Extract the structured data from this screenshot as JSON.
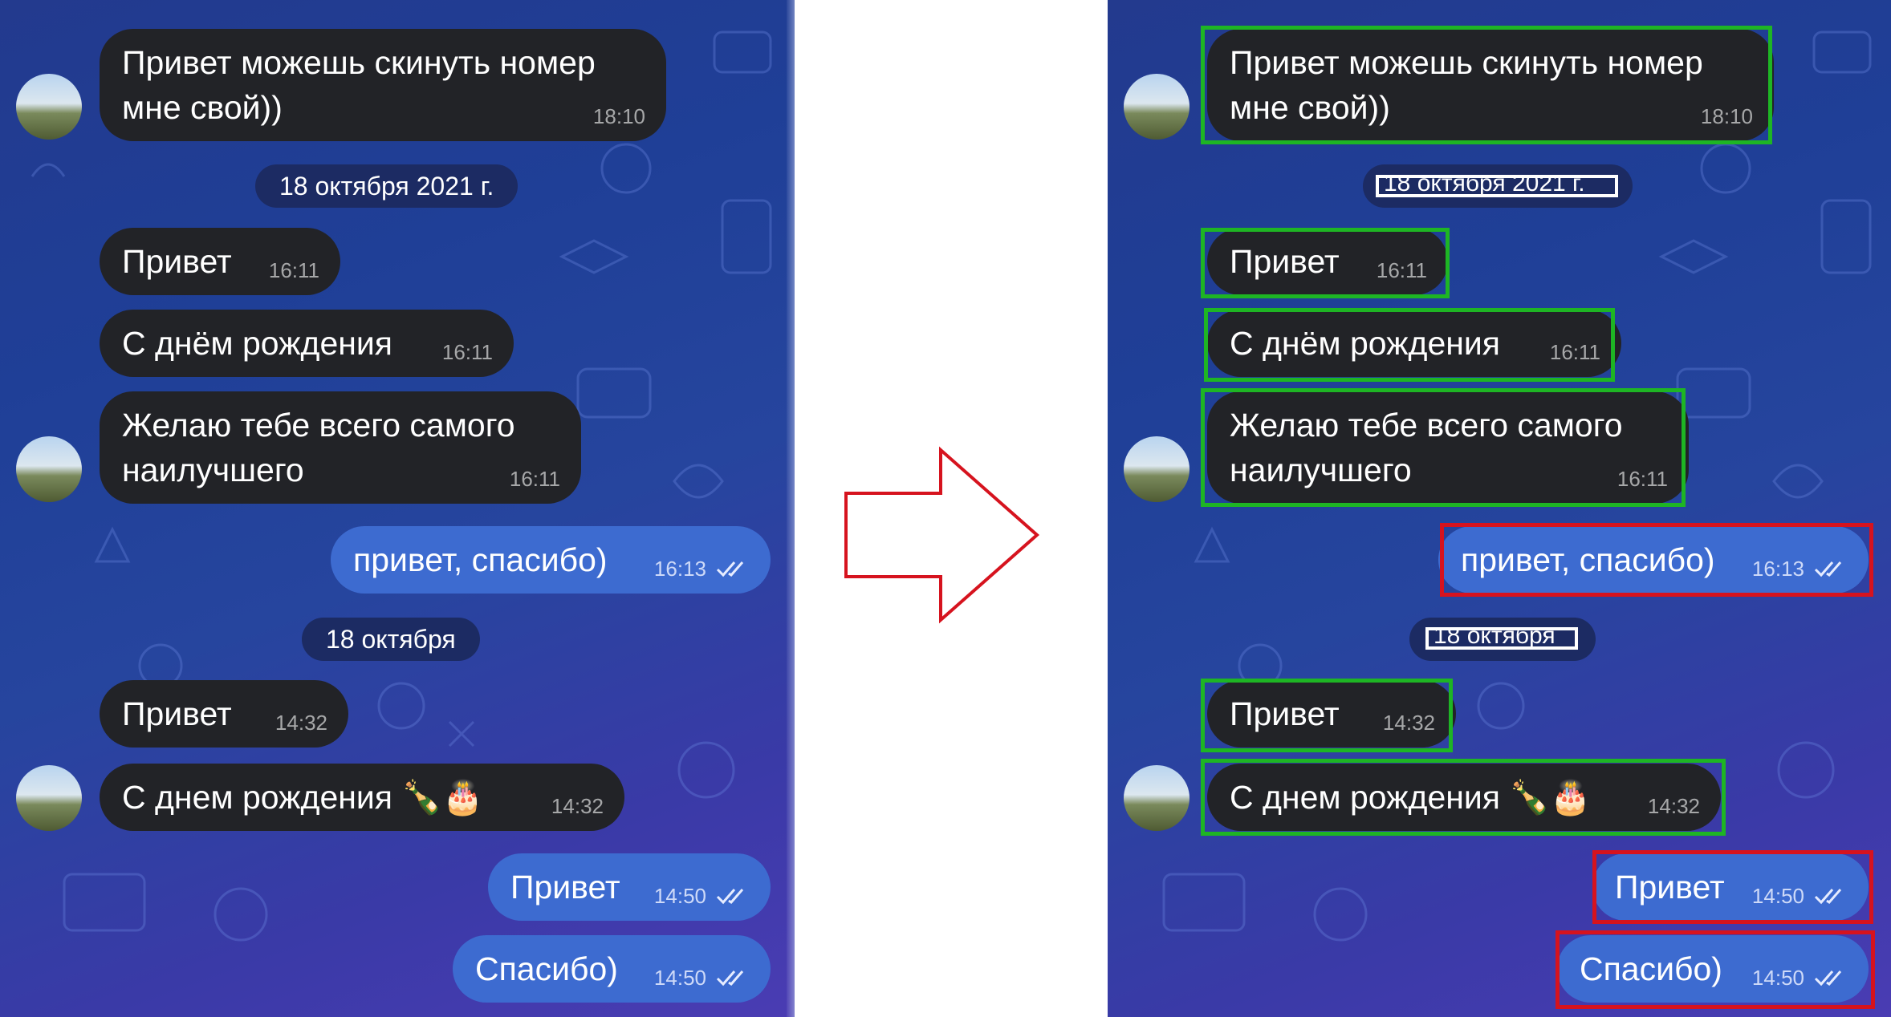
{
  "messages": {
    "m1": {
      "text": "Привет можешь скинуть номер мне свой))",
      "time": "18:10"
    },
    "date1": "18 октября 2021 г.",
    "m2": {
      "text": "Привет",
      "time": "16:11"
    },
    "m3": {
      "text": "С днём рождения",
      "time": "16:11"
    },
    "m4": {
      "text": "Желаю тебе всего самого наилучшего",
      "time": "16:11"
    },
    "m5": {
      "text": "привет, спасибо)",
      "time": "16:13"
    },
    "date2": "18 октября",
    "m6": {
      "text": "Привет",
      "time": "14:32"
    },
    "m7": {
      "text": "С днем рождения 🍾🎂",
      "time": "14:32"
    },
    "m8": {
      "text": "Привет",
      "time": "14:50"
    },
    "m9": {
      "text": "Спасибо)",
      "time": "14:50"
    }
  },
  "colors": {
    "incoming_bubble": "#222327",
    "outgoing_bubble": "#3d6bd0",
    "highlight_incoming": "#1eb524",
    "highlight_outgoing": "#d6131e",
    "arrow": "#d6131e"
  }
}
